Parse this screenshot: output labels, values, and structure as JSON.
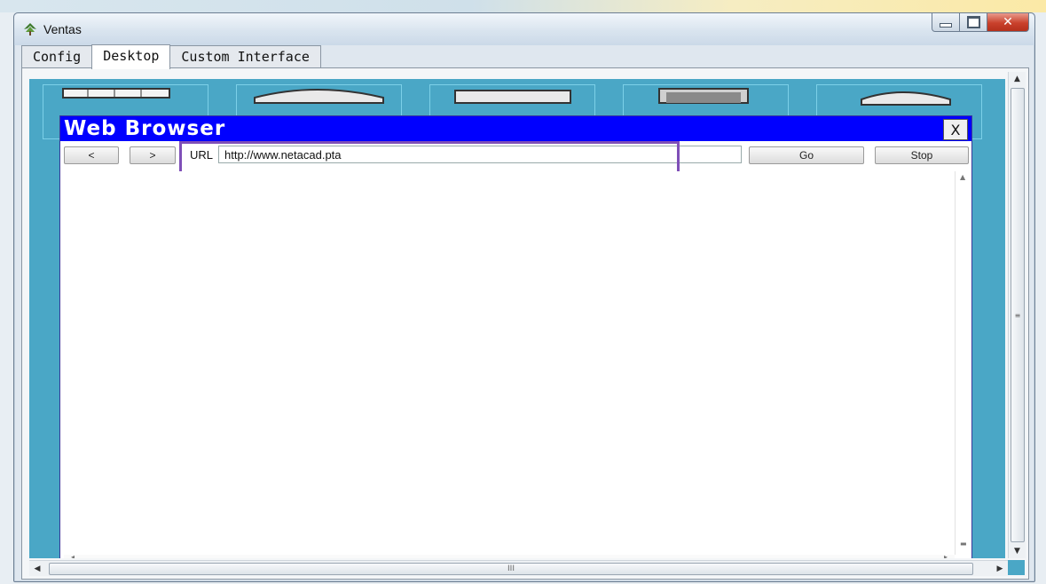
{
  "window": {
    "title": "Ventas",
    "icon": "tree-icon",
    "controls": {
      "minimize": "minimize-icon",
      "maximize": "maximize-icon",
      "close": "✕"
    }
  },
  "tabs": [
    {
      "label": "Config",
      "active": false
    },
    {
      "label": "Desktop",
      "active": true
    },
    {
      "label": "Custom Interface",
      "active": false
    }
  ],
  "browser": {
    "title": "Web Browser",
    "close": "X",
    "back": "<",
    "forward": ">",
    "url_label": "URL",
    "url": "http://www.netacad.pta",
    "go": "Go",
    "stop": "Stop"
  },
  "scrollbar": {
    "thumb_grip": "≡",
    "h_grip": "III"
  },
  "colors": {
    "desktop_bg": "#4aa7c6",
    "browser_titlebar": "#0000ff",
    "highlight_box": "#7f4fb8",
    "close_button": "#c9412c"
  }
}
